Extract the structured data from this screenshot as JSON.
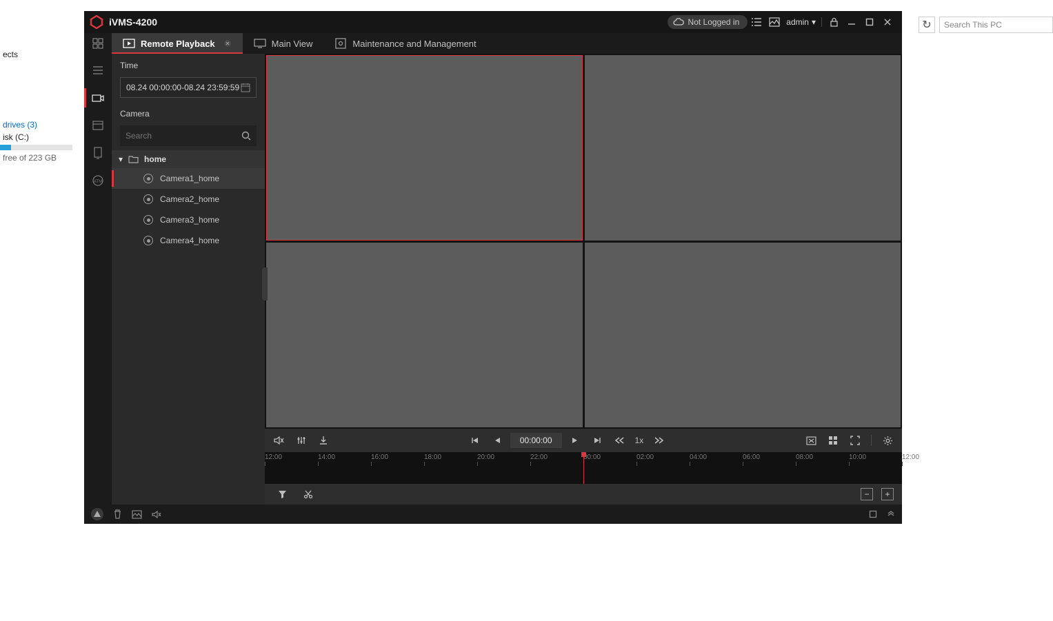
{
  "explorer": {
    "partial_text_1": "ects",
    "drives_link": "drives (3)",
    "disk_label": "isk (C:)",
    "disk_free": "free of 223 GB",
    "search_placeholder": "Search This PC"
  },
  "titlebar": {
    "app_name": "iVMS-4200",
    "login_status": "Not Logged in",
    "user": "admin"
  },
  "tabs": {
    "remote_playback": "Remote Playback",
    "main_view": "Main View",
    "maintenance": "Maintenance and Management"
  },
  "sidepanel": {
    "time_label": "Time",
    "time_range": "08.24 00:00:00-08.24 23:59:59",
    "camera_label": "Camera",
    "search_placeholder": "Search",
    "group_name": "home",
    "cameras": [
      "Camera1_home",
      "Camera2_home",
      "Camera3_home",
      "Camera4_home"
    ]
  },
  "playback": {
    "current_time": "00:00:00",
    "speed": "1x",
    "timeline_ticks": [
      "12:00",
      "14:00",
      "16:00",
      "18:00",
      "20:00",
      "22:00",
      "00:00",
      "02:00",
      "04:00",
      "06:00",
      "08:00",
      "10:00",
      "12:00"
    ],
    "playhead_percent": 50
  },
  "zoom_buttons": {
    "minus": "−",
    "plus": "+"
  }
}
